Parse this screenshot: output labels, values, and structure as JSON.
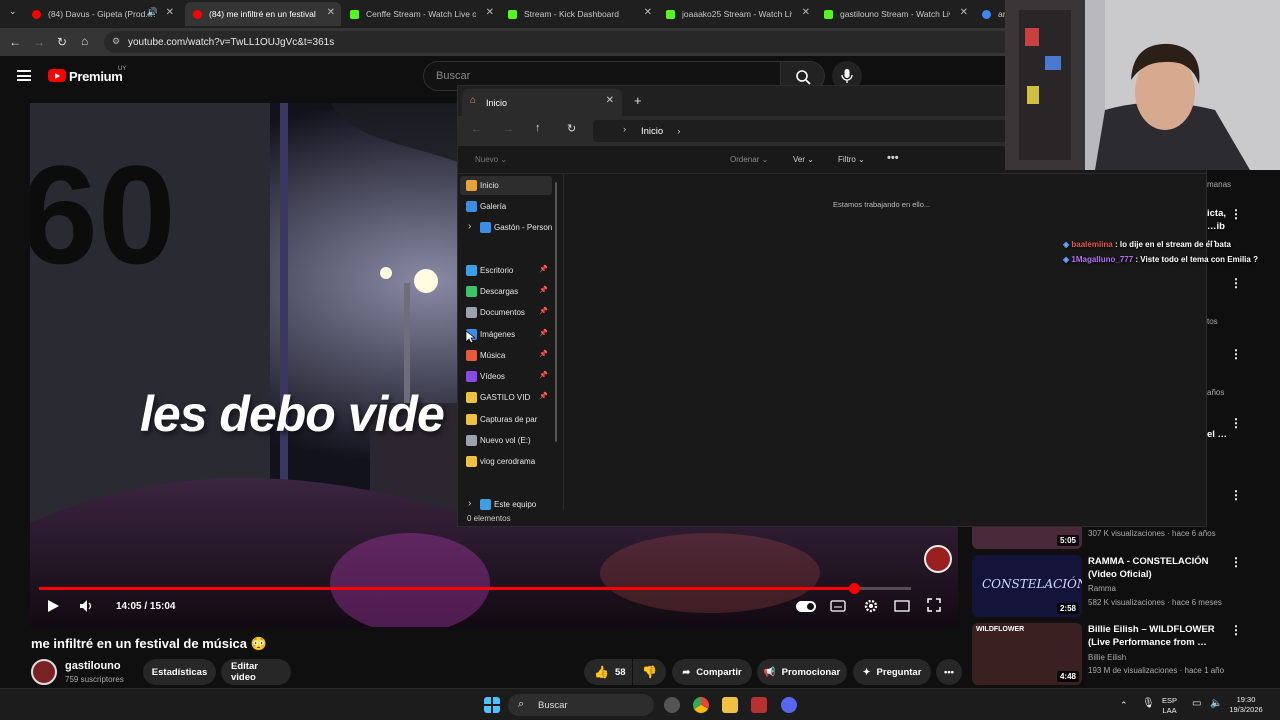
{
  "browser": {
    "tabs": [
      {
        "title": "(84) Davus - Gipeta (Prod. …",
        "favicon_color": "#ff0000",
        "active": false
      },
      {
        "title": "(84) me infiltré en un festival de …",
        "favicon_color": "#ff0000",
        "active": true
      },
      {
        "title": "Cenffe Stream - Watch Live on …",
        "favicon_color": "#53fc18",
        "active": false
      },
      {
        "title": "Stream - Kick Dashboard",
        "favicon_color": "#53fc18",
        "active": false
      },
      {
        "title": "joaaako25 Stream - Watch Live …",
        "favicon_color": "#53fc18",
        "active": false
      },
      {
        "title": "gastilouno Stream - Watch Live …",
        "favicon_color": "#53fc18",
        "active": false
      },
      {
        "title": "ar",
        "favicon_color": "#4285f4",
        "active": false
      }
    ],
    "url": "youtube.com/watch?v=TwLL1OUJgVc&t=361s"
  },
  "youtube": {
    "brand": "Premium",
    "country": "UY",
    "search_placeholder": "Buscar",
    "overlay_text": "les debo vide",
    "time_display": "14:05 / 15:04",
    "progress_fraction": 0.935,
    "video_title": "me infiltré en un festival de música 😳",
    "channel": {
      "name": "gastilouno",
      "subscribers": "759 suscriptores"
    },
    "buttons": {
      "stats": "Estadísticas",
      "edit": "Editar video",
      "likes": "58",
      "share": "Compartir",
      "promote": "Promocionar",
      "ask": "Preguntar"
    }
  },
  "recommendations": {
    "partial_texts": [
      "manas",
      "icta,",
      "…ib …",
      "tos",
      "años",
      "el …"
    ],
    "items": [
      {
        "title": "",
        "meta_line1": "",
        "meta_line2": "307 K visualizaciones · hace 6 años",
        "duration": "5:05"
      },
      {
        "title": "RAMMA - CONSTELACIÓN (Video Oficial)",
        "meta_line1": "Ramma",
        "meta_line2": "582 K visualizaciones · hace 6 meses",
        "duration": "2:58",
        "thumb_text": "CONSTELACIÓN"
      },
      {
        "title": "Billie Eilish – WILDFLOWER (Live Performance from …",
        "meta_line1": "Billie Eilish",
        "meta_line2": "193 M de visualizaciones · hace 1 año",
        "duration": "4:48",
        "thumb_text": "WILDFLOWER"
      }
    ]
  },
  "explorer": {
    "tab_title": "Inicio",
    "address": "Inicio",
    "commands": {
      "new": "Nuevo",
      "sort": "Ordenar",
      "view": "Ver",
      "filter": "Filtro"
    },
    "nav": [
      {
        "label": "Inicio",
        "icon": "home-icon",
        "color": "#e8a23a",
        "pinned": false,
        "selected": true
      },
      {
        "label": "Galería",
        "icon": "gallery-icon",
        "color": "#3a8ee8",
        "pinned": false
      },
      {
        "label": "Gastón - Person",
        "icon": "onedrive-icon",
        "color": "#3a8ee8",
        "pinned": false,
        "expandable": true
      },
      {
        "label": "Escritorio",
        "icon": "desktop-icon",
        "color": "#3aa0e8",
        "pinned": true
      },
      {
        "label": "Descargas",
        "icon": "download-icon",
        "color": "#3ac46a",
        "pinned": true
      },
      {
        "label": "Documentos",
        "icon": "documents-icon",
        "color": "#9aa3ad",
        "pinned": true
      },
      {
        "label": "Imágenes",
        "icon": "pictures-icon",
        "color": "#3a8ee8",
        "pinned": true
      },
      {
        "label": "Música",
        "icon": "music-icon",
        "color": "#e85a3a",
        "pinned": true
      },
      {
        "label": "Vídeos",
        "icon": "videos-icon",
        "color": "#8a4ae8",
        "pinned": true
      },
      {
        "label": "GASTILO VID",
        "icon": "folder-icon",
        "color": "#f0c040",
        "pinned": true
      },
      {
        "label": "Capturas de par",
        "icon": "folder-icon",
        "color": "#f0c040",
        "pinned": false
      },
      {
        "label": "Nuevo vol (E:)",
        "icon": "drive-icon",
        "color": "#9aa3ad",
        "pinned": false
      },
      {
        "label": "vlog cerodrama",
        "icon": "folder-icon",
        "color": "#f0c040",
        "pinned": false
      },
      {
        "label": "Este equipo",
        "icon": "pc-icon",
        "color": "#3aa0e8",
        "pinned": false,
        "expandable": true
      }
    ],
    "working_text": "Estamos trabajando en ello...",
    "status": "0 elementos"
  },
  "chat": [
    {
      "user": "baalemiina",
      "user_color": "#e8544a",
      "message": "lo dije en el stream de el bata"
    },
    {
      "user": "1Magalluno_777",
      "user_color": "#b46cf0",
      "message": "Viste todo el tema con Emilia ?"
    }
  ],
  "taskbar": {
    "search_label": "Buscar",
    "lang_line1": "ESP",
    "lang_line2": "LAA",
    "time": "19:30",
    "date": "19/3/2026"
  }
}
